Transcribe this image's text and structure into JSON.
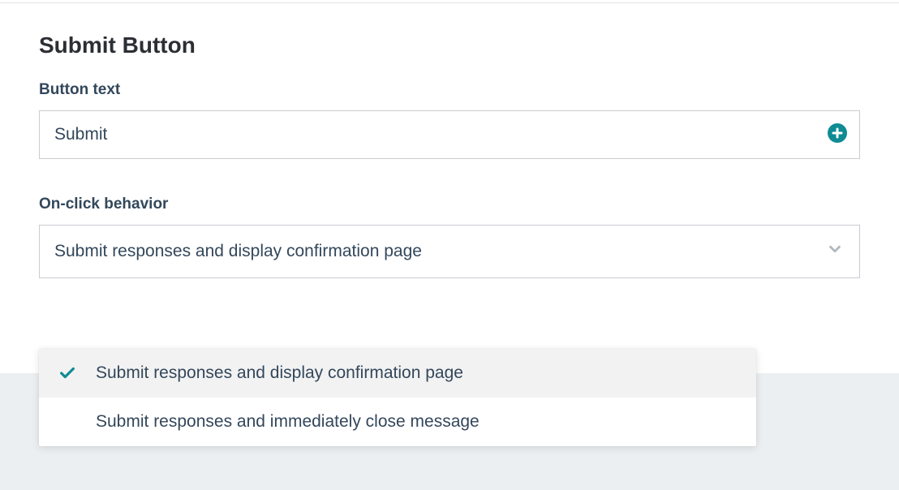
{
  "section": {
    "title": "Submit Button"
  },
  "fields": {
    "button_text": {
      "label": "Button text",
      "value": "Submit"
    },
    "on_click": {
      "label": "On-click behavior",
      "selected": "Submit responses and display confirmation page",
      "options": [
        "Submit responses and display confirmation page",
        "Submit responses and immediately close message"
      ]
    }
  },
  "colors": {
    "accent": "#00838f",
    "text": "#33475b",
    "border": "#c9ccd0",
    "chevron": "#b0b8c0",
    "selected_bg": "#f2f2f2"
  }
}
